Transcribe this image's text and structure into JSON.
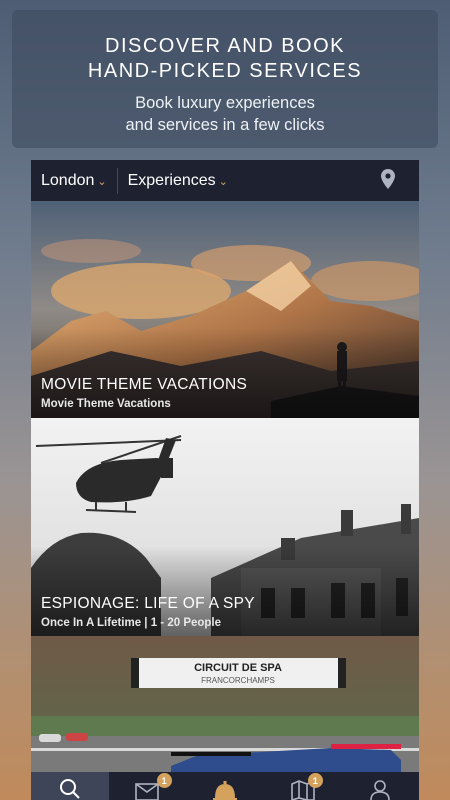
{
  "promo": {
    "headline_line1": "DISCOVER AND BOOK",
    "headline_line2": "HAND-PICKED SERVICES",
    "sub_line1": "Book luxury experiences",
    "sub_line2": "and services in a few clicks"
  },
  "topbar": {
    "city": "London",
    "category": "Experiences",
    "location_icon": "map-pin-icon"
  },
  "cards": [
    {
      "title": "MOVIE THEME VACATIONS",
      "subtitle": "Movie Theme Vacations"
    },
    {
      "title": "ESPIONAGE: LIFE OF A SPY",
      "subtitle": "Once In A Lifetime | 1 - 20 People"
    },
    {
      "title": "",
      "subtitle": "",
      "sign_line1": "CIRCUIT DE SPA",
      "sign_line2": "FRANCORCHAMPS"
    }
  ],
  "tabbar": {
    "tabs": [
      {
        "icon": "search-icon",
        "active": true
      },
      {
        "icon": "mail-icon",
        "badge": "1"
      },
      {
        "icon": "concierge-bell-icon"
      },
      {
        "icon": "map-icon",
        "badge": "1"
      },
      {
        "icon": "user-icon"
      }
    ]
  },
  "colors": {
    "accent": "#d5a25e",
    "bar": "#1e2130"
  }
}
